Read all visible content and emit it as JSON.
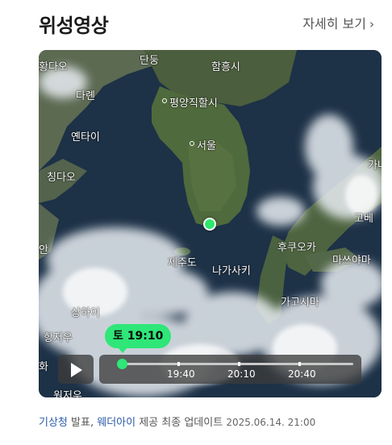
{
  "header": {
    "title": "위성영상",
    "more_label": "자세히 보기",
    "more_icon": "chevron-right-icon"
  },
  "map": {
    "places": {
      "handong": "단둥",
      "hwangdao": "황다오",
      "hamheung": "함흥시",
      "dalian": "다롄",
      "pyongyang": "평양직할시",
      "yantai": "옌타이",
      "seoul": "서울",
      "qingdao": "칭다오",
      "gana": "가나",
      "kobe": "고베",
      "an": "안",
      "fukuoka": "후쿠오카",
      "matsuyama": "마쓰야마",
      "jeju": "제주도",
      "nagasaki": "나가사키",
      "kagoshima": "가고시마",
      "shanghai": "상하이",
      "hangzhou": "항저우",
      "hwa": "화",
      "wenzhou": "원저우"
    },
    "marker_color": "#2ee86c"
  },
  "player": {
    "current_time": "토 19:10",
    "ticks": [
      "19:40",
      "20:10",
      "20:40"
    ],
    "play_icon": "play-icon",
    "accent": "#2fe678"
  },
  "footer": {
    "source": "기상청",
    "sep1": "발표,",
    "provider": "웨더아이",
    "rest": "제공 최종 업데이트",
    "datetime": "2025.06.14. 21:00"
  }
}
